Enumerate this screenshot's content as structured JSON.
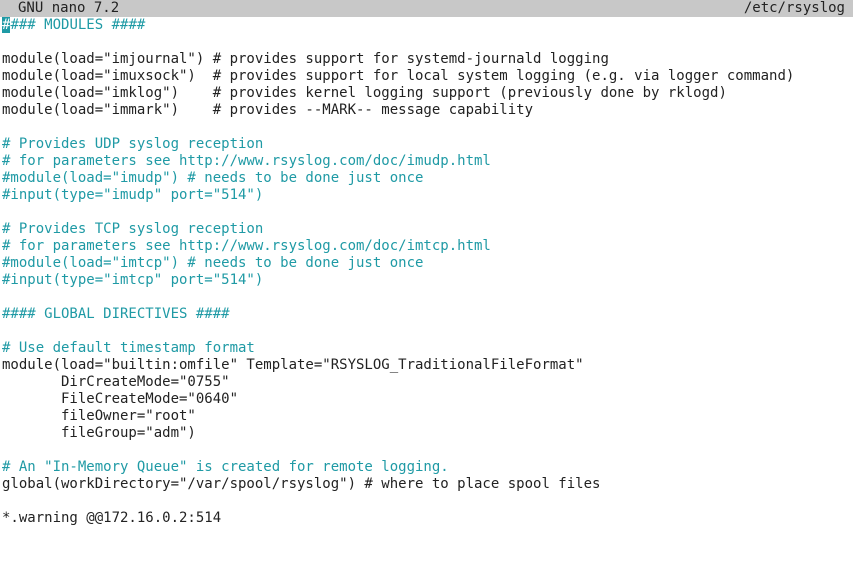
{
  "titlebar": {
    "app_name": "GNU nano 7.2",
    "file_name": "/etc/rsyslog"
  },
  "colors": {
    "comment": "#1f9aa5",
    "text": "#222222",
    "titlebar_bg": "#c8c8c8",
    "background": "#ffffff"
  },
  "editor": {
    "cursor_char": "#",
    "lines": [
      {
        "text": "### MODULES ####",
        "type": "comment"
      },
      {
        "text": "",
        "type": "text"
      },
      {
        "text": "module(load=\"imjournal\") # provides support for systemd-journald logging",
        "type": "text"
      },
      {
        "text": "module(load=\"imuxsock\")  # provides support for local system logging (e.g. via logger command)",
        "type": "text"
      },
      {
        "text": "module(load=\"imklog\")    # provides kernel logging support (previously done by rklogd)",
        "type": "text"
      },
      {
        "text": "module(load=\"immark\")    # provides --MARK-- message capability",
        "type": "text"
      },
      {
        "text": "",
        "type": "text"
      },
      {
        "text": "# Provides UDP syslog reception",
        "type": "comment"
      },
      {
        "text": "# for parameters see http://www.rsyslog.com/doc/imudp.html",
        "type": "comment"
      },
      {
        "text": "#module(load=\"imudp\") # needs to be done just once",
        "type": "comment"
      },
      {
        "text": "#input(type=\"imudp\" port=\"514\")",
        "type": "comment"
      },
      {
        "text": "",
        "type": "text"
      },
      {
        "text": "# Provides TCP syslog reception",
        "type": "comment"
      },
      {
        "text": "# for parameters see http://www.rsyslog.com/doc/imtcp.html",
        "type": "comment"
      },
      {
        "text": "#module(load=\"imtcp\") # needs to be done just once",
        "type": "comment"
      },
      {
        "text": "#input(type=\"imtcp\" port=\"514\")",
        "type": "comment"
      },
      {
        "text": "",
        "type": "text"
      },
      {
        "text": "#### GLOBAL DIRECTIVES ####",
        "type": "comment"
      },
      {
        "text": "",
        "type": "text"
      },
      {
        "text": "# Use default timestamp format",
        "type": "comment"
      },
      {
        "text": "module(load=\"builtin:omfile\" Template=\"RSYSLOG_TraditionalFileFormat\"",
        "type": "text"
      },
      {
        "text": "       DirCreateMode=\"0755\"",
        "type": "text"
      },
      {
        "text": "       FileCreateMode=\"0640\"",
        "type": "text"
      },
      {
        "text": "       fileOwner=\"root\"",
        "type": "text"
      },
      {
        "text": "       fileGroup=\"adm\")",
        "type": "text"
      },
      {
        "text": "",
        "type": "text"
      },
      {
        "text": "# An \"In-Memory Queue\" is created for remote logging.",
        "type": "comment"
      },
      {
        "text": "global(workDirectory=\"/var/spool/rsyslog\") # where to place spool files",
        "type": "text"
      },
      {
        "text": "",
        "type": "text"
      },
      {
        "text": "*.warning @@172.16.0.2:514",
        "type": "text"
      }
    ]
  }
}
